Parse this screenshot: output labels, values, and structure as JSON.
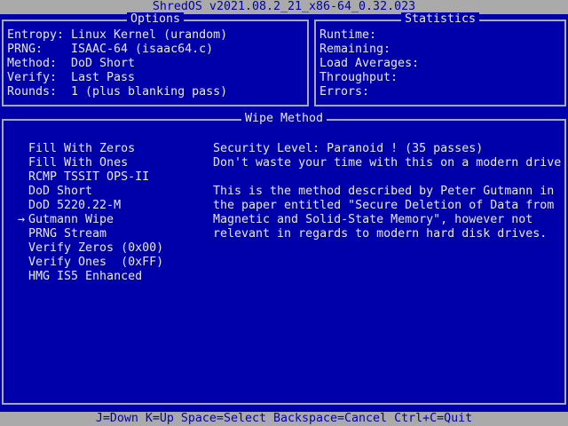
{
  "title": "ShredOS v2021.08.2_21_x86-64_0.32.023",
  "options": {
    "title": "Options",
    "rows": [
      {
        "label": "Entropy:",
        "value": "Linux Kernel (urandom)"
      },
      {
        "label": "PRNG:",
        "value": "ISAAC-64 (isaac64.c)"
      },
      {
        "label": "Method:",
        "value": "DoD Short"
      },
      {
        "label": "Verify:",
        "value": "Last Pass"
      },
      {
        "label": "Rounds:",
        "value": "1 (plus blanking pass)"
      }
    ]
  },
  "statistics": {
    "title": "Statistics",
    "rows": [
      "Runtime:",
      "Remaining:",
      "Load Averages:",
      "Throughput:",
      "Errors:"
    ]
  },
  "wipe": {
    "title": "Wipe Method",
    "selected_marker": "→",
    "selected_index": 5,
    "methods": [
      "Fill With Zeros",
      "Fill With Ones",
      "RCMP TSSIT OPS-II",
      "DoD Short",
      "DoD 5220.22-M",
      "Gutmann Wipe",
      "PRNG Stream",
      "Verify Zeros (0x00)",
      "Verify Ones  (0xFF)",
      "HMG IS5 Enhanced"
    ],
    "description": [
      "Security Level: Paranoid ! (35 passes)",
      "Don't waste your time with this on a modern drive",
      "",
      "This is the method described by Peter Gutmann in",
      "the paper entitled \"Secure Deletion of Data from",
      "Magnetic and Solid-State Memory\", however not",
      "relevant in regards to modern hard disk drives."
    ]
  },
  "status_bar": "J=Down K=Up Space=Select Backspace=Cancel Ctrl+C=Quit",
  "colors": {
    "background": "#0000aa",
    "foreground": "#e8e8e8",
    "bar": "#aaaaaa"
  }
}
